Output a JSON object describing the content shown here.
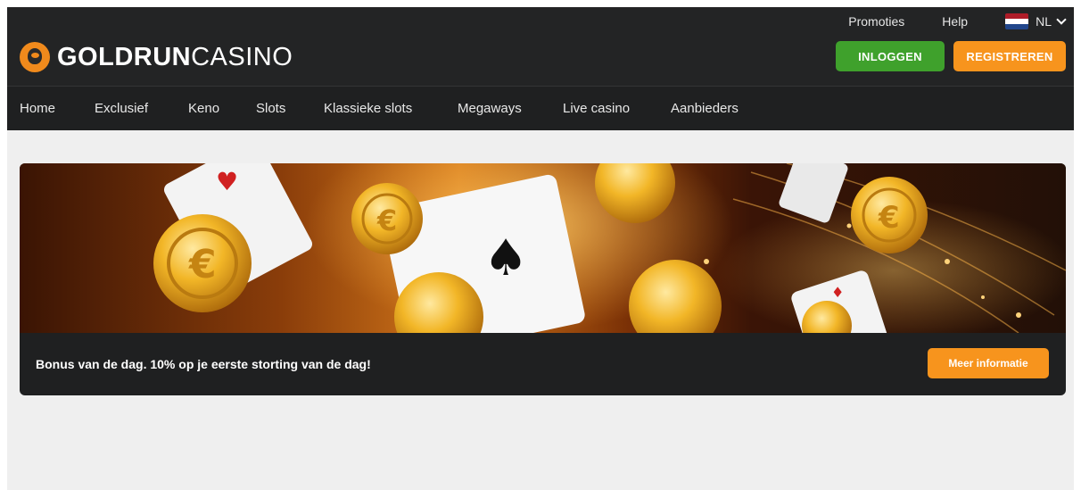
{
  "brand": {
    "name_bold": "GOLDRUN",
    "name_light": "CASINO"
  },
  "header": {
    "links": [
      "Promoties",
      "Help"
    ],
    "language": {
      "label": "NL",
      "flag_colors": [
        "#ae1c28",
        "#ffffff",
        "#21468b"
      ]
    },
    "login_label": "INLOGGEN",
    "register_label": "REGISTREREN"
  },
  "nav": {
    "items": [
      "Home",
      "Exclusief",
      "Keno",
      "Slots",
      "Klassieke slots",
      "Megaways",
      "Live casino",
      "Aanbieders"
    ]
  },
  "promo": {
    "text": "Bonus van de dag. 10% op je eerste storting van de dag!",
    "button_label": "Meer informatie"
  },
  "colors": {
    "header_bg": "#232425",
    "login_green": "#3fa12c",
    "accent_orange": "#f7941d",
    "page_bg": "#efefef"
  },
  "icons": [
    "goldrun-logo-icon",
    "nl-flag-icon",
    "chevron-down-icon",
    "coin-icon",
    "playing-card-icon"
  ]
}
